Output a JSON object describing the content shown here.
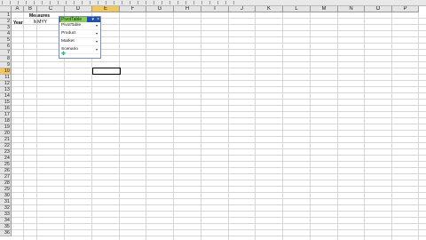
{
  "app": {
    "name": "Spreadsheet"
  },
  "columns": [
    "A",
    "B",
    "C",
    "D",
    "E",
    "F",
    "G",
    "H",
    "I",
    "J",
    "K",
    "L",
    "M",
    "N",
    "O",
    "P"
  ],
  "active_column": "E",
  "rows": [
    "1",
    "2",
    "3",
    "4",
    "5",
    "6",
    "7",
    "8",
    "9",
    "10",
    "11",
    "12",
    "13",
    "14",
    "15",
    "16",
    "17",
    "18",
    "19",
    "20",
    "21",
    "22",
    "23",
    "24",
    "25",
    "26",
    "27",
    "28",
    "29",
    "30",
    "31",
    "32",
    "33",
    "34",
    "35",
    "36"
  ],
  "active_row": "10",
  "cells": {
    "c1": "Measures",
    "a2": "Year",
    "c2": "MMYY"
  },
  "pivot_toolbar": {
    "title": "PivotTable",
    "items": [
      {
        "label": "PivotTable"
      },
      {
        "label": "Product"
      },
      {
        "label": "Market"
      },
      {
        "label": "Scenario"
      }
    ],
    "wizard_icon": "wizard-icon",
    "close_glyph": "×",
    "dropdown_glyph": "▾"
  },
  "colors": {
    "header_bg": "#e4e4e4",
    "active_header": "#f2c75c",
    "toolbar_title": "#1f4fa8",
    "highlight": "#9fe04a"
  }
}
